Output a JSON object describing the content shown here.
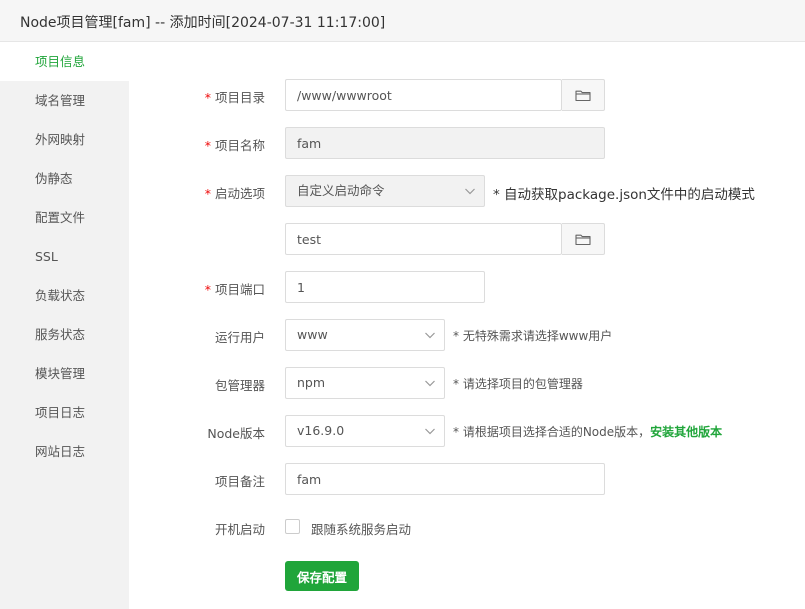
{
  "window": {
    "title": "Node项目管理[fam] -- 添加时间[2024-07-31 11:17:00]"
  },
  "sidebar": {
    "items": [
      {
        "label": "项目信息",
        "active": true
      },
      {
        "label": "域名管理"
      },
      {
        "label": "外网映射"
      },
      {
        "label": "伪静态"
      },
      {
        "label": "配置文件"
      },
      {
        "label": "SSL"
      },
      {
        "label": "负载状态"
      },
      {
        "label": "服务状态"
      },
      {
        "label": "模块管理"
      },
      {
        "label": "项目日志"
      },
      {
        "label": "网站日志"
      }
    ]
  },
  "form": {
    "required_mark": "*",
    "project_dir": {
      "label": "项目目录",
      "value": "/www/wwwroot"
    },
    "project_name": {
      "label": "项目名称",
      "value": "fam"
    },
    "start_option": {
      "label": "启动选项",
      "selected": "自定义启动命令",
      "hint": "* 自动获取package.json文件中的启动模式",
      "command_value": "test"
    },
    "project_port": {
      "label": "项目端口",
      "value": "1"
    },
    "run_user": {
      "label": "运行用户",
      "selected": "www",
      "hint": "* 无特殊需求请选择www用户"
    },
    "package_manager": {
      "label": "包管理器",
      "selected": "npm",
      "hint": "* 请选择项目的包管理器"
    },
    "node_version": {
      "label": "Node版本",
      "selected": "v16.9.0",
      "hint": "* 请根据项目选择合适的Node版本，",
      "link": "安装其他版本"
    },
    "remark": {
      "label": "项目备注",
      "value": "fam"
    },
    "autostart": {
      "label": "开机启动",
      "checkbox_label": "跟随系统服务启动",
      "checked": false
    },
    "save_label": "保存配置"
  },
  "colors": {
    "accent": "#20a53a",
    "required": "#ef0808"
  },
  "icons": {
    "folder": "folder-icon",
    "dropdown": "chevron-down-icon"
  }
}
